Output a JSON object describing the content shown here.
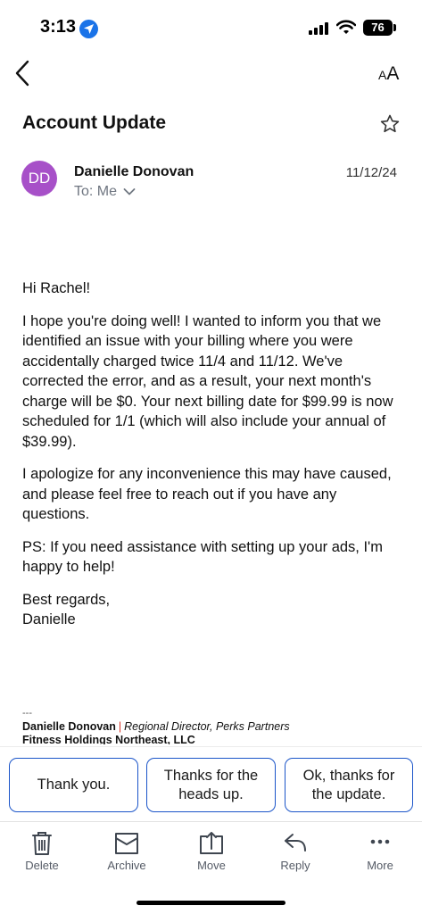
{
  "status_bar": {
    "time": "3:13",
    "battery": "76"
  },
  "header": {
    "text_size_small": "A",
    "text_size_large": "A"
  },
  "email": {
    "subject": "Account Update",
    "sender_initials": "DD",
    "sender_name": "Danielle Donovan",
    "recipient": "To: Me",
    "date": "11/12/24",
    "greeting": "Hi Rachel!",
    "paragraph_1": "I hope you're doing well! I wanted to inform you that we identified an issue with your billing where you were accidentally charged twice 11/4 and 11/12. We've corrected the error, and as a result, your next month's charge will be $0. Your next billing date for $99.99 is now scheduled for 1/1 (which will also include your annual of $39.99).",
    "paragraph_2": "I apologize for any inconvenience this may have caused, and please feel free to reach out if you have any questions.",
    "paragraph_3": "PS: If you need assistance with setting up your ads, I'm happy to help!",
    "closing": "Best regards,\nDanielle",
    "signature": {
      "separator": "---",
      "name": "Danielle Donovan",
      "divider": "|",
      "title": "Regional Director, Perks Partners",
      "company": "Fitness Holdings Northeast, LLC"
    }
  },
  "quick_replies": [
    {
      "label": "Thank you."
    },
    {
      "label": "Thanks for the heads up."
    },
    {
      "label": "Ok, thanks for the update."
    }
  ],
  "toolbar": {
    "delete": "Delete",
    "archive": "Archive",
    "move": "Move",
    "reply": "Reply",
    "more": "More"
  },
  "colors": {
    "avatar": "#a750c8",
    "accent_blue": "#1b55c9",
    "location_blue": "#1a73e8",
    "signature_divider": "#d93025"
  },
  "icons": [
    "location-arrow-icon",
    "cellular-signal-icon",
    "wifi-icon",
    "battery-icon",
    "back-chevron-icon",
    "text-size-icon",
    "star-icon",
    "chevron-down-icon",
    "trash-icon",
    "archive-icon",
    "move-icon",
    "reply-icon",
    "more-icon"
  ]
}
